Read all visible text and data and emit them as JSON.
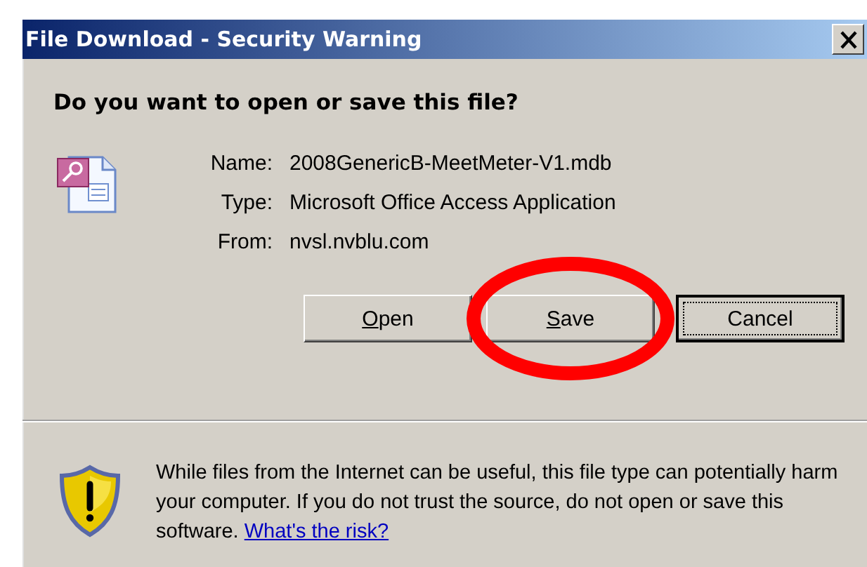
{
  "window": {
    "title": "File Download - Security Warning"
  },
  "heading": "Do you want to open or save this file?",
  "file_info": [
    {
      "label": "Name:",
      "value": "2008GenericB-MeetMeter-V1.mdb"
    },
    {
      "label": "Type:",
      "value": "Microsoft Office Access Application"
    },
    {
      "label": "From:",
      "value": "nvsl.nvblu.com"
    }
  ],
  "buttons": [
    {
      "label": "Open",
      "access_key_underlined": true,
      "default": false,
      "circled": false
    },
    {
      "label": "Save",
      "access_key_underlined": true,
      "default": false,
      "circled": true
    },
    {
      "label": "Cancel",
      "access_key_underlined": false,
      "default": true,
      "circled": false
    }
  ],
  "warning": {
    "text": "While files from the Internet can be useful, this file type can potentially harm your computer. If you do not trust the source, do not open or save this software.",
    "link": "What's the risk?"
  }
}
